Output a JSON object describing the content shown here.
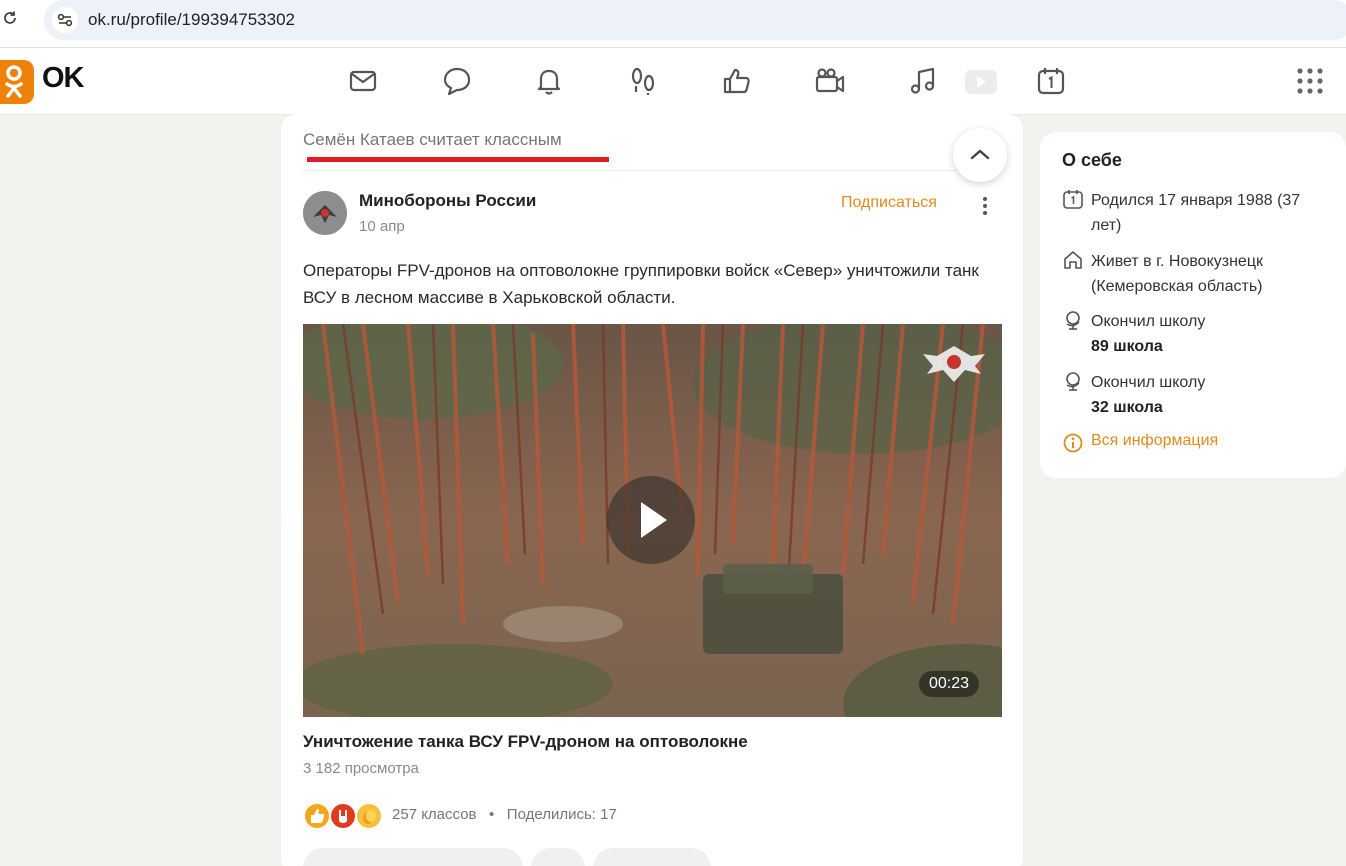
{
  "browser": {
    "url": "ok.ru/profile/199394753302"
  },
  "app": {
    "logo_text": "OK",
    "nav_icons": [
      "mail-icon",
      "chat-icon",
      "bell-icon",
      "footprints-icon",
      "like-icon",
      "video-camera-icon",
      "music-icon",
      "video-play-icon",
      "calendar-icon",
      "apps-grid-icon"
    ]
  },
  "feed": {
    "liked_by": "Семён Катаев считает классным",
    "post": {
      "author": "Минобороны России",
      "date": "10 апр",
      "subscribe_label": "Подписаться",
      "text": "Операторы FPV-дронов на оптоволокне группировки войск «Север» уничтожили танк ВСУ в лесном массиве в Харьковской области.",
      "video": {
        "duration": "00:23",
        "title": "Уничтожение танка ВСУ FPV-дроном на оптоволокне",
        "views": "3 182 просмотра"
      },
      "reactions_count": "257 классов",
      "separator": "•",
      "shares": "Поделились: 17"
    }
  },
  "about": {
    "title": "О себе",
    "born": "Родился 17 января 1988 (37 лет)",
    "lives": "Живет в г. Новокузнецк (Кемеровская область)",
    "school1_label": "Окончил школу",
    "school1_name": "89 школа",
    "school2_label": "Окончил школу",
    "school2_name": "32 школа",
    "all_info": "Вся информация"
  },
  "colors": {
    "brand": "#ee8208",
    "accent_link": "#e08a1d",
    "annotation_underline": "#e31b23"
  }
}
